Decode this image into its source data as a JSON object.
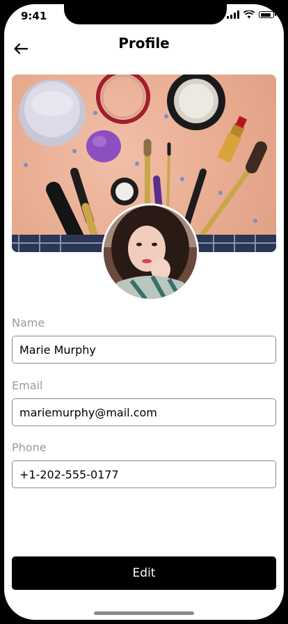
{
  "status_bar": {
    "time": "9:41"
  },
  "header": {
    "title": "Profile",
    "back_icon": "arrow-left-icon"
  },
  "cover": {
    "alt": "makeup flat-lay cover photo"
  },
  "avatar": {
    "alt": "profile photo"
  },
  "fields": [
    {
      "label": "Name",
      "value": "Marie Murphy"
    },
    {
      "label": "Email",
      "value": "mariemurphy@mail.com"
    },
    {
      "label": "Phone",
      "value": "+1-202-555-0177"
    }
  ],
  "edit_button": {
    "label": "Edit"
  },
  "colors": {
    "button_bg": "#000000",
    "label_gray": "#9a9a9a",
    "border_gray": "#8a8a8a"
  }
}
